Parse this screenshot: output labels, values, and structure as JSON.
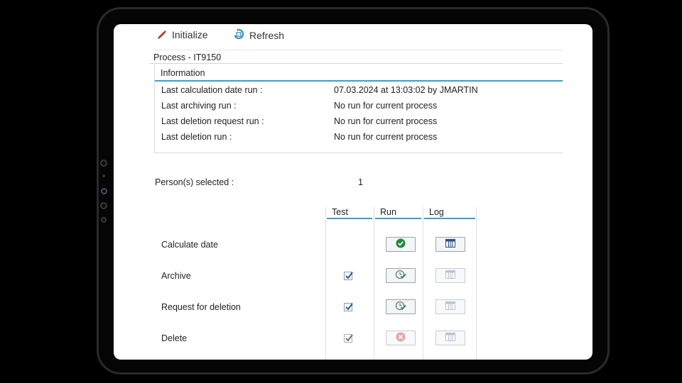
{
  "toolbar": {
    "initialize_label": "Initialize",
    "refresh_label": "Refresh"
  },
  "process": {
    "title": "Process - IT9150"
  },
  "information": {
    "header": "Information",
    "rows": [
      {
        "label": "Last calculation date run :",
        "value": "07.03.2024 at 13:03:02 by JMARTIN"
      },
      {
        "label": "Last archiving run :",
        "value": "No run for current process"
      },
      {
        "label": "Last deletion request run :",
        "value": "No run for current process"
      },
      {
        "label": "Last deletion run :",
        "value": "No run for current process"
      }
    ]
  },
  "persons": {
    "label": "Person(s) selected :",
    "count": "1"
  },
  "grid": {
    "columns": [
      "Test",
      "Run",
      "Log"
    ],
    "rows": [
      {
        "label": "Calculate date",
        "test": null,
        "run_icon": "check-circle-icon",
        "log_enabled": true
      },
      {
        "label": "Archive",
        "test": true,
        "run_icon": "execute-clock-icon",
        "log_enabled": false
      },
      {
        "label": "Request for deletion",
        "test": true,
        "run_icon": "execute-clock-icon",
        "log_enabled": false
      },
      {
        "label": "Delete",
        "test": true,
        "run_icon": "error-circle-icon",
        "log_enabled": false
      }
    ]
  },
  "colors": {
    "accent_line": "#3aa0c8",
    "success": "#1e8a3c",
    "error": "#e05a5a"
  }
}
